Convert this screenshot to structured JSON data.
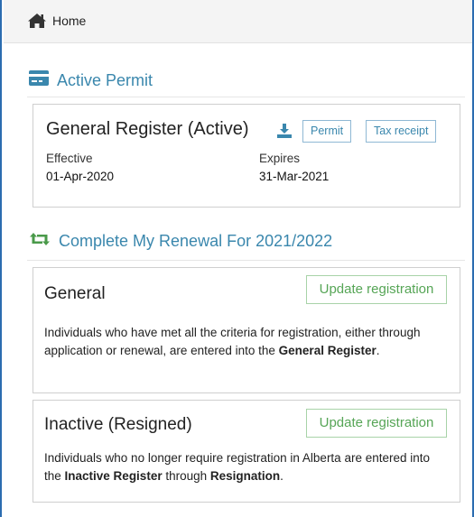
{
  "nav": {
    "home_label": "Home"
  },
  "active_permit": {
    "heading": "Active Permit",
    "title": "General Register (Active)",
    "permit_button": "Permit",
    "tax_receipt_button": "Tax receipt",
    "effective_label": "Effective",
    "effective_date": "01-Apr-2020",
    "expires_label": "Expires",
    "expires_date": "31-Mar-2021"
  },
  "renewal": {
    "heading": "Complete My Renewal For 2021/2022",
    "options": [
      {
        "title": "General",
        "button": "Update registration",
        "desc_1": "Individuals who have met all the criteria for registration, either through application or renewal, are entered into the ",
        "desc_bold_1": "General Register",
        "desc_2": "."
      },
      {
        "title": "Inactive (Resigned)",
        "button": "Update registration",
        "desc_1": "Individuals who no longer require registration in Alberta are entered into the ",
        "desc_bold_1": "Inactive Register",
        "desc_2": " through ",
        "desc_bold_2": "Resignation",
        "desc_3": "."
      }
    ]
  },
  "colors": {
    "accent_blue": "#3a87ad",
    "accent_green": "#56a556",
    "frame_blue": "#2b6cb0"
  },
  "icons": {
    "home": "home-icon",
    "card": "credit-card-icon",
    "renew": "retweet-icon",
    "download": "download-icon"
  }
}
